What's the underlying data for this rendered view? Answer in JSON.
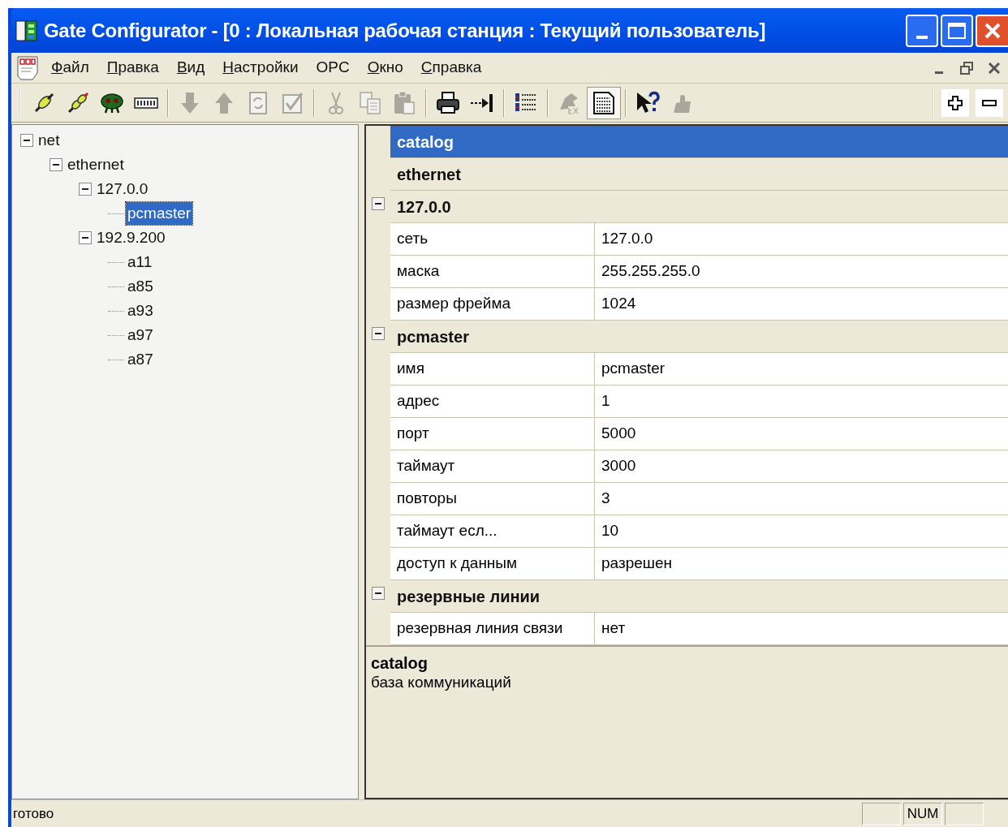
{
  "window": {
    "title": "Gate Configurator - [0 : Локальная рабочая станция : Текущий пользователь]"
  },
  "menu": [
    {
      "label": "Файл",
      "mnemonic": true
    },
    {
      "label": "Правка",
      "mnemonic": true
    },
    {
      "label": "Вид",
      "mnemonic": true
    },
    {
      "label": "Настройки",
      "mnemonic": true
    },
    {
      "label": "OPC",
      "mnemonic": false
    },
    {
      "label": "Окно",
      "mnemonic": true
    },
    {
      "label": "Справка",
      "mnemonic": true
    }
  ],
  "toolbar": [
    [
      {
        "kind": "plug",
        "disabled": false,
        "pressed": false
      },
      {
        "kind": "plug2",
        "disabled": false,
        "pressed": false
      },
      {
        "kind": "bug",
        "disabled": false,
        "pressed": false
      },
      {
        "kind": "keys",
        "disabled": false,
        "pressed": false
      }
    ],
    [
      {
        "kind": "down",
        "disabled": true,
        "pressed": false
      },
      {
        "kind": "up",
        "disabled": true,
        "pressed": false
      },
      {
        "kind": "refresh",
        "disabled": true,
        "pressed": false
      },
      {
        "kind": "check",
        "disabled": true,
        "pressed": false
      }
    ],
    [
      {
        "kind": "cut",
        "disabled": true,
        "pressed": false
      },
      {
        "kind": "copy",
        "disabled": true,
        "pressed": false
      },
      {
        "kind": "paste",
        "disabled": true,
        "pressed": false
      }
    ],
    [
      {
        "kind": "print",
        "disabled": false,
        "pressed": false
      },
      {
        "kind": "tab",
        "disabled": false,
        "pressed": false
      }
    ],
    [
      {
        "kind": "list",
        "disabled": false,
        "pressed": false
      }
    ],
    [
      {
        "kind": "export",
        "disabled": true,
        "pressed": false
      },
      {
        "kind": "doc",
        "disabled": false,
        "pressed": true
      }
    ],
    [
      {
        "kind": "help",
        "disabled": false,
        "pressed": false
      },
      {
        "kind": "puzzle",
        "disabled": true,
        "pressed": false
      }
    ]
  ],
  "zoom_buttons": [
    {
      "kind": "plus"
    },
    {
      "kind": "minus"
    }
  ],
  "tree": [
    {
      "label": "net",
      "expanded": true,
      "selected": false,
      "children": [
        {
          "label": "ethernet",
          "expanded": true,
          "selected": false,
          "children": [
            {
              "label": "127.0.0",
              "expanded": true,
              "selected": false,
              "children": [
                {
                  "label": "pcmaster",
                  "selected": true
                }
              ]
            },
            {
              "label": "192.9.200",
              "expanded": true,
              "selected": false,
              "children": [
                {
                  "label": "a11",
                  "selected": false
                },
                {
                  "label": "a85",
                  "selected": false
                },
                {
                  "label": "a93",
                  "selected": false
                },
                {
                  "label": "a97",
                  "selected": false
                },
                {
                  "label": "a87",
                  "selected": false
                }
              ]
            }
          ]
        }
      ]
    }
  ],
  "properties": [
    {
      "kind": "category",
      "label": "catalog",
      "selected": true
    },
    {
      "kind": "category",
      "label": "ethernet",
      "selected": false
    },
    {
      "kind": "category",
      "label": "127.0.0",
      "selected": false,
      "expanded": true
    },
    {
      "kind": "property",
      "name": "сеть",
      "value": "127.0.0"
    },
    {
      "kind": "property",
      "name": "маска",
      "value": "255.255.255.0"
    },
    {
      "kind": "property",
      "name": "размер фрейма",
      "value": "1024"
    },
    {
      "kind": "category",
      "label": "pcmaster",
      "selected": false,
      "expanded": true
    },
    {
      "kind": "property",
      "name": "имя",
      "value": "pcmaster"
    },
    {
      "kind": "property",
      "name": "адрес",
      "value": "1"
    },
    {
      "kind": "property",
      "name": "порт",
      "value": "5000"
    },
    {
      "kind": "property",
      "name": "таймаут",
      "value": "3000"
    },
    {
      "kind": "property",
      "name": "повторы",
      "value": "3"
    },
    {
      "kind": "property",
      "name": "таймаут есл...",
      "value": "10"
    },
    {
      "kind": "property",
      "name": "доступ к данным",
      "value": "разрешен"
    },
    {
      "kind": "category",
      "label": "резервные линии",
      "selected": false,
      "expanded": true
    },
    {
      "kind": "property",
      "name": "резервная линия связи",
      "value": "нет"
    }
  ],
  "description": {
    "title": "catalog",
    "text": "база коммуникаций"
  },
  "status_bar": {
    "text": "готово",
    "panels": [
      {
        "kind": "blank"
      },
      {
        "kind": "text",
        "text": "NUM"
      },
      {
        "kind": "blank"
      }
    ]
  }
}
